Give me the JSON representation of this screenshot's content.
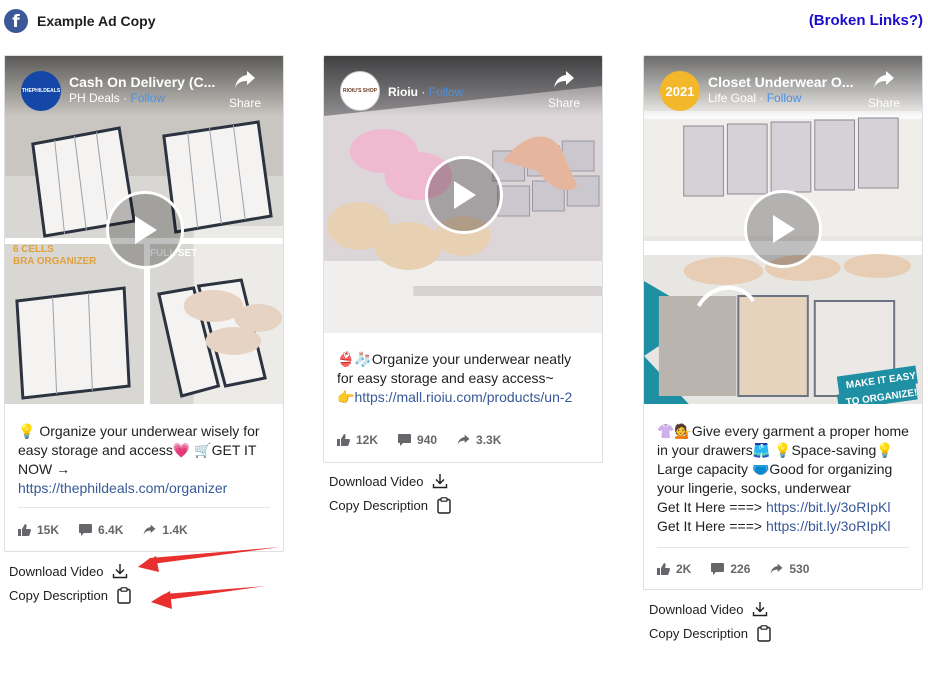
{
  "header": {
    "platform_icon": "facebook-icon",
    "title": "Example Ad Copy",
    "broken_links": "(Broken Links?)"
  },
  "share_label": "Share",
  "actions": {
    "download": "Download Video",
    "copy": "Copy Description"
  },
  "ads": [
    {
      "page_name": "Cash On Delivery (C...",
      "page_sub": "PH Deals",
      "follow": "Follow",
      "avatar_text": "THEPHILDEALS",
      "overlay_text_1": "6 CELLS",
      "overlay_text_2": "BRA ORGANIZER",
      "overlay_text_3": "FULL SET",
      "desc_lines": [
        "💡 Organize your underwear wisely for",
        "easy storage and access💗 🛒GET IT",
        "NOW →"
      ],
      "link": "https://thephildeals.com/organizer",
      "likes": "15K",
      "comments": "6.4K",
      "shares": "1.4K"
    },
    {
      "page_name": "Rioiu",
      "page_sub": "",
      "follow": "Follow",
      "avatar_text": "RIOIU'S SHOP",
      "desc_lines": [
        "👙🧦Organize your underwear neatly",
        "for easy storage and easy access~"
      ],
      "link_prefix": "👉",
      "link": "https://mall.rioiu.com/products/un-2",
      "likes": "12K",
      "comments": "940",
      "shares": "3.3K"
    },
    {
      "page_name": "Closet Underwear O...",
      "page_sub": "Life Goal",
      "follow": "Follow",
      "avatar_text": "2021",
      "overlay_text_1": "MAKE IT EASY",
      "overlay_text_2": "TO ORGANIZE!",
      "desc_lines": [
        "👚💁Give every garment a proper home",
        "in your drawers🩳 💡Space-saving💡",
        "Large capacity 🩲Good for organizing",
        "your lingerie, socks, underwear"
      ],
      "get_it_prefix": "Get It Here ===>",
      "get_it_link": "https://bit.ly/3oRIpKl",
      "likes": "2K",
      "comments": "226",
      "shares": "530"
    }
  ]
}
